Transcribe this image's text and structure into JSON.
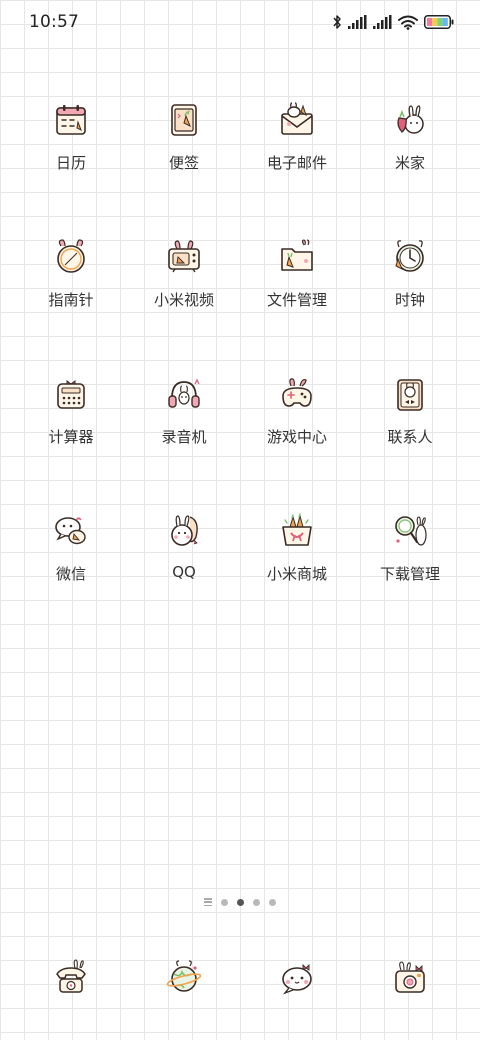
{
  "status_bar": {
    "time": "10:57",
    "icons": [
      "bluetooth-icon",
      "signal-icon",
      "signal-icon",
      "wifi-icon",
      "battery-icon"
    ],
    "battery_colors": [
      "#f27b9c",
      "#f7c94f",
      "#7dd37a",
      "#66b7f2"
    ]
  },
  "apps": [
    {
      "label": "日历",
      "icon": "calendar-icon"
    },
    {
      "label": "便签",
      "icon": "notes-icon"
    },
    {
      "label": "电子邮件",
      "icon": "email-icon"
    },
    {
      "label": "米家",
      "icon": "mijia-icon"
    },
    {
      "label": "指南针",
      "icon": "compass-icon"
    },
    {
      "label": "小米视频",
      "icon": "video-icon"
    },
    {
      "label": "文件管理",
      "icon": "file-manager-icon"
    },
    {
      "label": "时钟",
      "icon": "clock-icon"
    },
    {
      "label": "计算器",
      "icon": "calculator-icon"
    },
    {
      "label": "录音机",
      "icon": "recorder-icon"
    },
    {
      "label": "游戏中心",
      "icon": "game-center-icon"
    },
    {
      "label": "联系人",
      "icon": "contacts-icon"
    },
    {
      "label": "微信",
      "icon": "wechat-icon"
    },
    {
      "label": "QQ",
      "icon": "qq-icon"
    },
    {
      "label": "小米商城",
      "icon": "mi-store-icon"
    },
    {
      "label": "下载管理",
      "icon": "download-manager-icon"
    }
  ],
  "page_indicator": {
    "pages": 4,
    "active_page": 2
  },
  "dock": [
    {
      "icon": "phone-icon"
    },
    {
      "icon": "browser-icon"
    },
    {
      "icon": "messages-icon"
    },
    {
      "icon": "camera-icon"
    }
  ],
  "colors": {
    "outline": "#3a2c25",
    "pink": "#f2a7b5",
    "orange": "#f0a24c",
    "green": "#7cbf6a",
    "cream": "#fff6e8"
  }
}
